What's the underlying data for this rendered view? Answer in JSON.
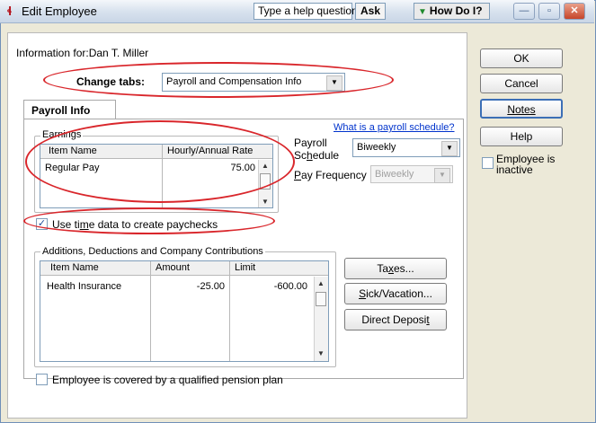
{
  "window": {
    "title": "Edit Employee",
    "help_prompt": "Type a help question",
    "ask_label": "Ask",
    "how_do_i_label": "How Do I?",
    "minimize_glyph": "—",
    "maximize_glyph": "▫",
    "close_glyph": "✕"
  },
  "info": {
    "label": "Information for:",
    "employee_name": "Dan T. Miller"
  },
  "change_tabs": {
    "label": "Change tabs:",
    "selected": "Payroll and Compensation Info"
  },
  "tabs": [
    {
      "label": "Payroll Info",
      "active": true
    }
  ],
  "schedule_link": "What is a payroll schedule?",
  "earnings": {
    "group_label": "Earnings",
    "headers": [
      "Item Name",
      "Hourly/Annual Rate"
    ],
    "rows": [
      {
        "item": "Regular Pay",
        "rate": "75.00"
      }
    ]
  },
  "payroll_schedule": {
    "label_line1": "Payroll",
    "label_line2_pre": "Sc",
    "label_line2_u": "h",
    "label_line2_post": "edule",
    "value": "Biweekly"
  },
  "pay_frequency": {
    "label_u": "P",
    "label_rest": "ay Frequency",
    "value": "Biweekly",
    "disabled": true
  },
  "use_time_data": {
    "checked": true,
    "check_glyph": "✓",
    "label_pre": "Use ti",
    "label_u": "m",
    "label_post": "e data to create paychecks"
  },
  "additions": {
    "group_label": "Additions, Deductions and Company Contributions",
    "headers": [
      "Item Name",
      "Amount",
      "Limit"
    ],
    "rows": [
      {
        "item": "Health Insurance",
        "amount": "-25.00",
        "limit": "-600.00"
      }
    ]
  },
  "side_buttons": {
    "taxes_pre": "Ta",
    "taxes_u": "x",
    "taxes_post": "es...",
    "sick_u": "S",
    "sick_rest": "ick/Vacation...",
    "direct_pre": "Direct Deposi",
    "direct_u": "t"
  },
  "pension": {
    "checked": false,
    "label": "Employee is covered by a qualified pension plan"
  },
  "right_panel": {
    "ok_label": "OK",
    "cancel_label": "Cancel",
    "notes_label": "Notes",
    "help_label": "Help",
    "inactive_label_line1": "Employee is",
    "inactive_label_line2": "inactive",
    "inactive_checked": false
  },
  "colors": {
    "annotation": "#d9262b",
    "link": "#0033cc",
    "accent_green": "#1f8a2d"
  }
}
